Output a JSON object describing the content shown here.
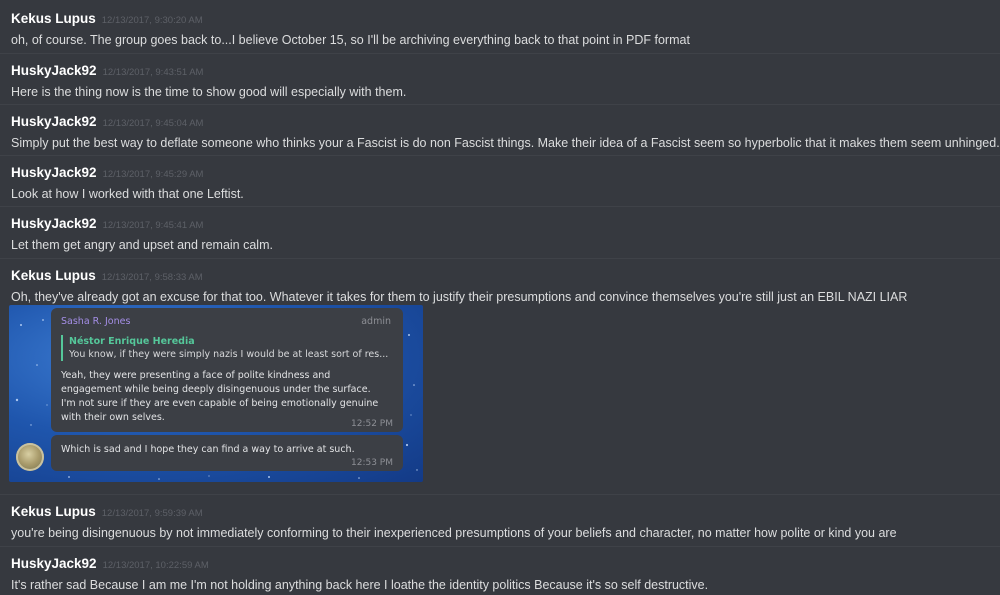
{
  "messages": [
    {
      "author": "Kekus Lupus",
      "timestamp": "12/13/2017, 9:30:20 AM",
      "text": "oh, of course.  The group goes back to...I believe October 15, so I'll be archiving everything back to that point in PDF format"
    },
    {
      "author": "HuskyJack92",
      "timestamp": "12/13/2017, 9:43:51 AM",
      "text": "Here is the thing now is the time to show good will especially with them."
    },
    {
      "author": "HuskyJack92",
      "timestamp": "12/13/2017, 9:45:04 AM",
      "text": "Simply put the best way to deflate someone who thinks your a Fascist is do non Fascist things. Make their idea of a Fascist seem so hyperbolic that it makes them seem unhinged."
    },
    {
      "author": "HuskyJack92",
      "timestamp": "12/13/2017, 9:45:29 AM",
      "text": "Look at how I worked with that one Leftist."
    },
    {
      "author": "HuskyJack92",
      "timestamp": "12/13/2017, 9:45:41 AM",
      "text": "Let them get angry and upset and remain calm."
    },
    {
      "author": "Kekus Lupus",
      "timestamp": "12/13/2017, 9:58:33 AM",
      "text": "Oh, they've already got an excuse for that too.  Whatever it takes for them to justify their presumptions and convince themselves you're still just an EBIL NAZI LIAR"
    },
    {
      "author": "Kekus Lupus",
      "timestamp": "12/13/2017, 9:59:39 AM",
      "text": "you're being disingenuous by not immediately conforming to their inexperienced presumptions of your beliefs and character, no matter how polite or kind you are"
    },
    {
      "author": "HuskyJack92",
      "timestamp": "12/13/2017, 10:22:59 AM",
      "text": "It's rather sad Because I am me I'm not holding anything back here I loathe the identity politics Because it's so self destructive."
    }
  ],
  "embed": {
    "sender": "Sasha R. Jones",
    "role": "admin",
    "reply_name": "Néstor Enrique Heredia",
    "reply_text": "You know, if they were simply nazis I would be at least sort of res...",
    "message1_lines": [
      "Yeah, they were presenting a face of polite kindness and",
      "engagement while being deeply disingenuous under the surface.",
      "I'm not sure if they are even capable of being emotionally genuine",
      "with their own selves."
    ],
    "time1": "12:52 PM",
    "message2": "Which is sad and I hope they can find a way to arrive at such.",
    "time2": "12:53 PM"
  }
}
